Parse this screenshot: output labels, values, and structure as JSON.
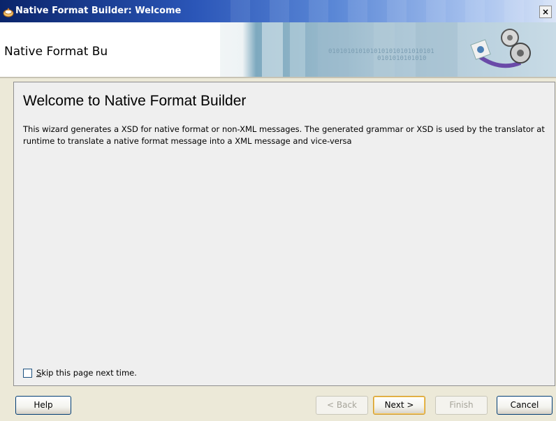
{
  "window": {
    "title": "Native Format Builder: Welcome",
    "close_glyph": "×"
  },
  "banner": {
    "title": "Native Format Builder: Welcome",
    "binary_text": "0101010101010101010101010101",
    "binary_text2": "0101010101010"
  },
  "content": {
    "heading": "Welcome to Native Format Builder",
    "description": "This wizard generates a XSD for native format or non-XML messages. The generated grammar or XSD is used by the translator at runtime to translate a native format message into a XML message and vice-versa"
  },
  "skip": {
    "label_prefix": "S",
    "label_rest": "kip this page next time.",
    "checked": false
  },
  "buttons": {
    "help": "Help",
    "back": "< Back",
    "next": "Next >",
    "finish": "Finish",
    "cancel": "Cancel"
  },
  "icons": {
    "app": "oracle-app-icon",
    "banner": "gears-arrow-icon"
  },
  "colors": {
    "titlebar_start": "#0a246a",
    "titlebar_end": "#d6e2f6",
    "default_button_border": "#ce9a32"
  }
}
